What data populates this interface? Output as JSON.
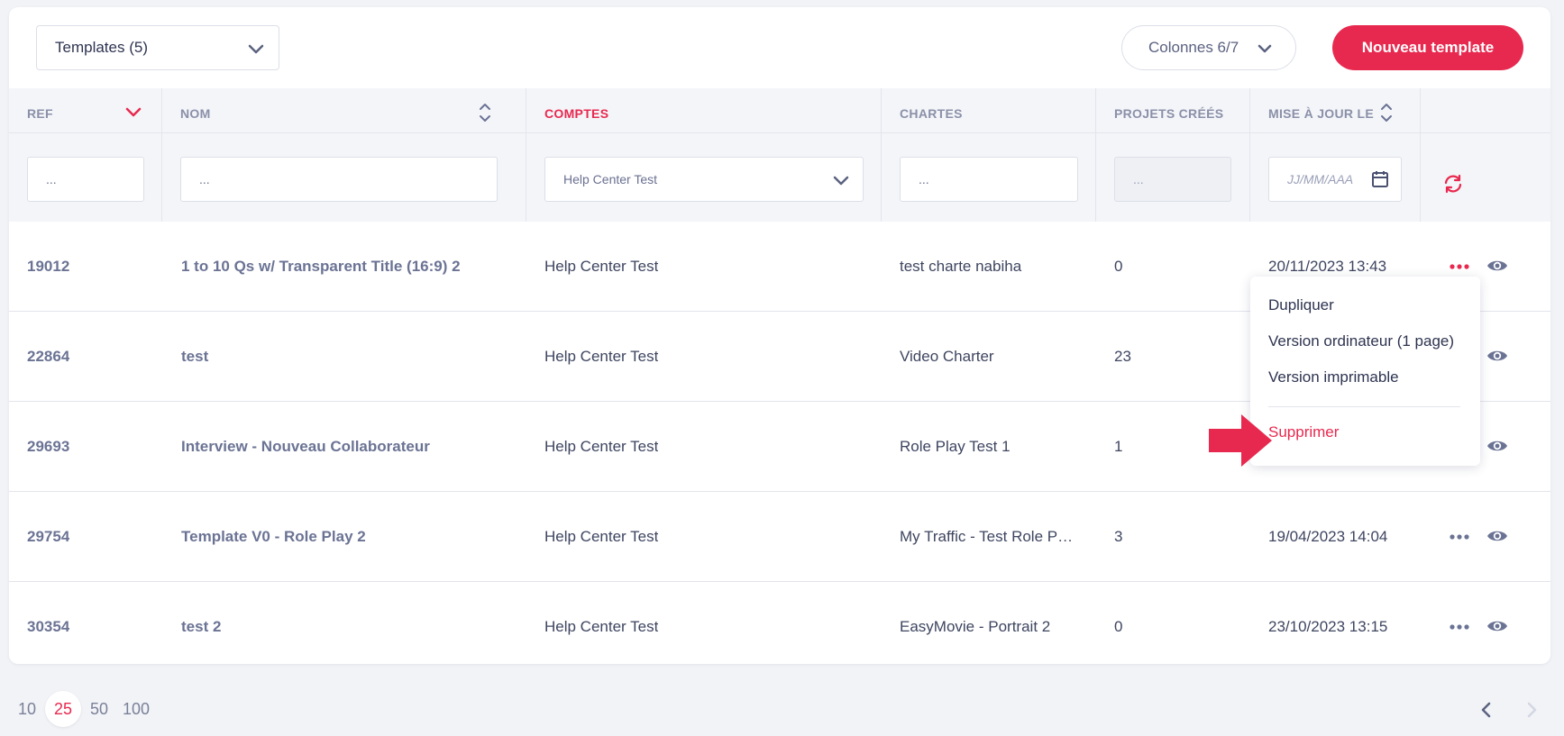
{
  "toolbar": {
    "templates_select": "Templates (5)",
    "columns_button": "Colonnes 6/7",
    "new_button": "Nouveau template"
  },
  "columns": {
    "ref": "REF",
    "nom": "NOM",
    "comptes": "COMPTES",
    "chartes": "CHARTES",
    "projets": "PROJETS CRÉÉS",
    "maj": "MISE À JOUR LE"
  },
  "filters": {
    "ref_placeholder": "...",
    "nom_placeholder": "...",
    "comptes_value": "Help Center Test",
    "chartes_placeholder": "...",
    "projets_placeholder": "...",
    "date_placeholder": "JJ/MM/AAA"
  },
  "rows": [
    {
      "ref": "19012",
      "nom": "1 to 10 Qs w/ Transparent Title (16:9) 2",
      "compte": "Help Center Test",
      "charte": "test charte nabiha",
      "projets": "0",
      "date": "20/11/2023 13:43"
    },
    {
      "ref": "22864",
      "nom": "test",
      "compte": "Help Center Test",
      "charte": "Video Charter",
      "projets": "23",
      "date": ""
    },
    {
      "ref": "29693",
      "nom": "Interview - Nouveau Collaborateur",
      "compte": "Help Center Test",
      "charte": "Role Play Test 1",
      "projets": "1",
      "date": ""
    },
    {
      "ref": "29754",
      "nom": "Template V0 - Role Play 2",
      "compte": "Help Center Test",
      "charte": "My Traffic - Test Role P…",
      "projets": "3",
      "date": "19/04/2023 14:04"
    },
    {
      "ref": "30354",
      "nom": "test 2",
      "compte": "Help Center Test",
      "charte": "EasyMovie - Portrait 2",
      "projets": "0",
      "date": "23/10/2023 13:15"
    }
  ],
  "context_menu": {
    "duplicate": "Dupliquer",
    "desktop": "Version ordinateur (1 page)",
    "print": "Version imprimable",
    "delete": "Supprimer"
  },
  "pagination": {
    "sizes": [
      "10",
      "25",
      "50",
      "100"
    ],
    "active_size": "25"
  },
  "colors": {
    "accent": "#e8294f",
    "header_bg": "#f4f5f9",
    "muted_text": "#8a90a8"
  }
}
